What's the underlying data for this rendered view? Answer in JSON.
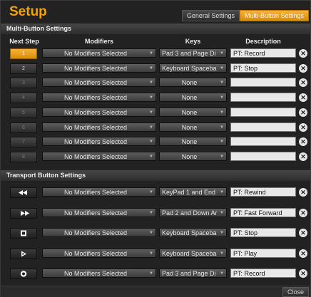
{
  "title": "Setup",
  "tabs": [
    {
      "label": "General Settings",
      "active": false
    },
    {
      "label": "Multi-Button Settings",
      "active": true
    }
  ],
  "multi_section": {
    "title": "Multi-Button Settings",
    "columns": {
      "next_step": "Next Step",
      "modifiers": "Modifiers",
      "keys": "Keys",
      "description": "Description"
    },
    "rows": [
      {
        "step": "1",
        "modifier": "No Modifiers Selected",
        "key": "Pad 3 and Page Di",
        "description": "PT: Record"
      },
      {
        "step": "2",
        "modifier": "No Modifiers Selected",
        "key": "Keyboard Spaceba",
        "description": "PT: Stop"
      },
      {
        "step": "3",
        "modifier": "No Modifiers Selected",
        "key": "None",
        "description": ""
      },
      {
        "step": "4",
        "modifier": "No Modifiers Selected",
        "key": "None",
        "description": ""
      },
      {
        "step": "5",
        "modifier": "No Modifiers Selected",
        "key": "None",
        "description": ""
      },
      {
        "step": "6",
        "modifier": "No Modifiers Selected",
        "key": "None",
        "description": ""
      },
      {
        "step": "7",
        "modifier": "No Modifiers Selected",
        "key": "None",
        "description": ""
      },
      {
        "step": "8",
        "modifier": "No Modifiers Selected",
        "key": "None",
        "description": ""
      }
    ]
  },
  "transport_section": {
    "title": "Transport Button Settings",
    "rows": [
      {
        "icon": "rewind-icon",
        "modifier": "No Modifiers Selected",
        "key": "KeyPad 1 and End",
        "description": "PT: Rewind"
      },
      {
        "icon": "fast-forward-icon",
        "modifier": "No Modifiers Selected",
        "key": "Pad 2 and Down Ar",
        "description": "PT: Fast Forward"
      },
      {
        "icon": "stop-icon",
        "modifier": "No Modifiers Selected",
        "key": "Keyboard Spaceba",
        "description": "PT: Stop"
      },
      {
        "icon": "play-icon",
        "modifier": "No Modifiers Selected",
        "key": "Keyboard Spaceba",
        "description": "PT: Play"
      },
      {
        "icon": "record-icon",
        "modifier": "No Modifiers Selected",
        "key": "Pad 3 and Page Di",
        "description": "PT: Record"
      }
    ]
  },
  "clear_glyph": "✕",
  "dropdown_arrow": "▼",
  "close_label": "Close",
  "colors": {
    "accent": "#f2a10d",
    "background": "#222222",
    "field": "#e8e8e8"
  }
}
